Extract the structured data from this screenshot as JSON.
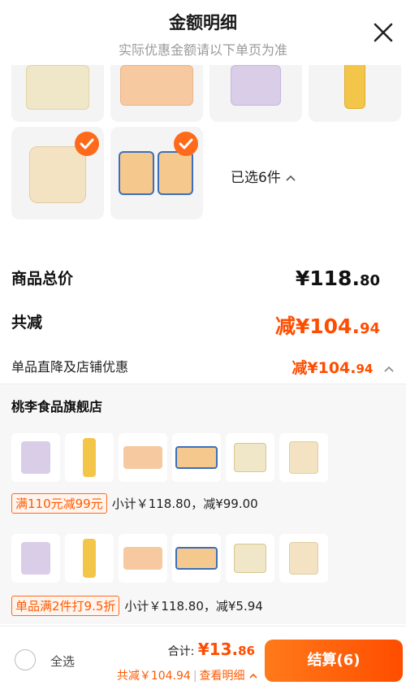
{
  "header": {
    "title": "金额明细",
    "subtitle": "实际优惠金额请以下单页为准"
  },
  "selection": {
    "count_label": "已选6件"
  },
  "summary": {
    "total_label": "商品总价",
    "total_value_main": "¥118.",
    "total_value_dec": "80",
    "reduce_label": "共减",
    "reduce_value_main": "减¥104.",
    "reduce_value_dec": "94",
    "direct_label": "单品直降及店铺优惠",
    "direct_value_main": "减¥104.",
    "direct_value_dec": "94"
  },
  "store": {
    "name": "桃李食品旗舰店",
    "promotions": [
      {
        "tag": "满110元减99元",
        "text": "小计￥118.80，减¥99.00"
      },
      {
        "tag": "单品满2件打9.5折",
        "text": "小计￥118.80，减¥5.94"
      }
    ]
  },
  "footer": {
    "select_all": "全选",
    "sum_label": "合计:",
    "sum_value_main": "¥13.",
    "sum_value_dec": "86",
    "saved_text": "共减￥104.94",
    "detail_label": "查看明细",
    "checkout_label": "结算(6)"
  },
  "colors": {
    "accent": "#ff4d00",
    "accent_light": "#ff6a1a",
    "panel_bg": "#f7f7f7"
  }
}
